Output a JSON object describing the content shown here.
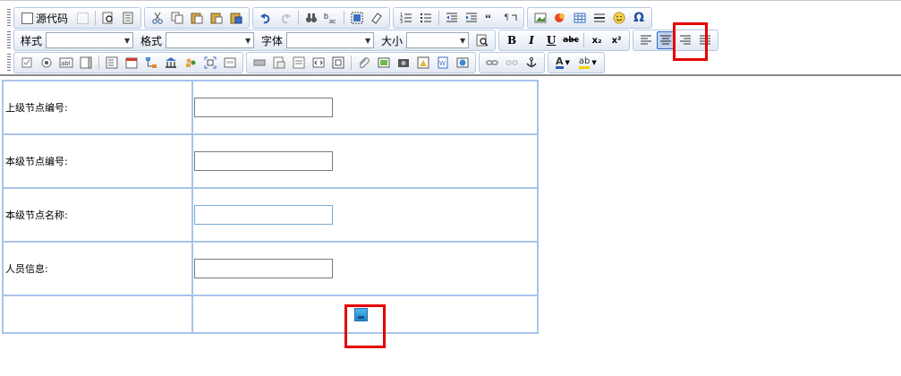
{
  "toolbar": {
    "source_label": "源代码",
    "style_label": "样式",
    "format_label": "格式",
    "font_label": "字体",
    "size_label": "大小",
    "bold": "B",
    "italic": "I",
    "underline": "U",
    "strike": "abc",
    "subscript": "x₂",
    "superscript": "x²",
    "omega": "Ω",
    "find": "A",
    "text_color": "A",
    "bg_color": "ab",
    "style_value": "",
    "format_value": "",
    "font_value": "",
    "size_value": ""
  },
  "form": {
    "rows": [
      {
        "label": "上级节点编号:",
        "value": ""
      },
      {
        "label": "本级节点编号:",
        "value": ""
      },
      {
        "label": "本级节点名称:",
        "value": ""
      },
      {
        "label": "人员信息:",
        "value": ""
      }
    ]
  },
  "colors": {
    "highlight": "#e60000",
    "table_border": "#a8c4ec",
    "active_button": "#c1d2ee"
  }
}
